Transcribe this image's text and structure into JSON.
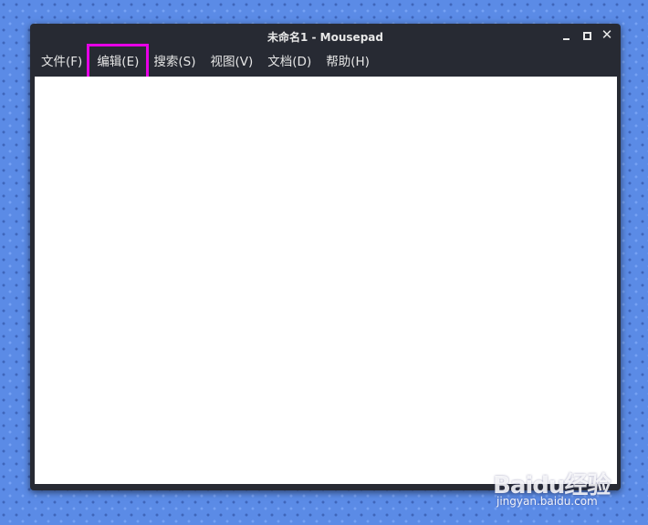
{
  "window": {
    "title": "未命名1 - Mousepad"
  },
  "menubar": {
    "items": [
      {
        "label": "文件(F)"
      },
      {
        "label": "编辑(E)"
      },
      {
        "label": "搜索(S)"
      },
      {
        "label": "视图(V)"
      },
      {
        "label": "文档(D)"
      },
      {
        "label": "帮助(H)"
      }
    ],
    "highlight_color": "#e600e6"
  },
  "editor": {
    "content": ""
  },
  "watermark": {
    "logo": "Baidu经验",
    "url": "jingyan.baidu.com"
  },
  "colors": {
    "desktop": "#5b8be6",
    "window_chrome": "#272a33",
    "text_light": "#e6e6e6",
    "editor_bg": "#ffffff"
  }
}
